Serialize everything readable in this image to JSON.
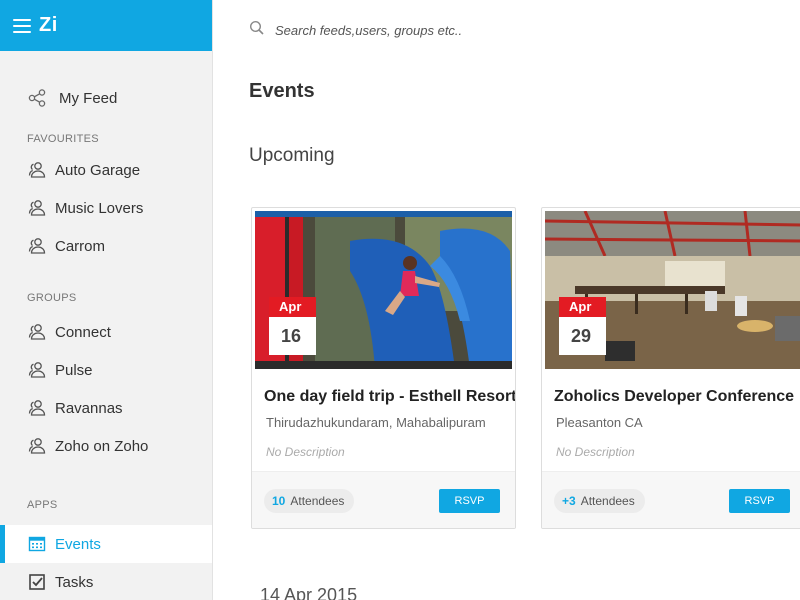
{
  "brand": {
    "logo_text": "Zi"
  },
  "search": {
    "placeholder": "Search feeds,users, groups etc.."
  },
  "sidebar": {
    "my_feed": "My Feed",
    "favourites_title": "FAVOURITES",
    "favourites": [
      "Auto Garage",
      "Music Lovers",
      "Carrom"
    ],
    "groups_title": "GROUPS",
    "groups": [
      "Connect",
      "Pulse",
      "Ravannas",
      "Zoho on Zoho"
    ],
    "apps_title": "APPS",
    "apps": [
      "Events",
      "Tasks"
    ]
  },
  "main": {
    "title": "Events",
    "section": "Upcoming",
    "date_heading": "14 Apr 2015"
  },
  "events": [
    {
      "month": "Apr",
      "day": "16",
      "title": "One day field trip - Esthell Resort",
      "location": "Thirudazhukundaram, Mahabalipuram",
      "description": "No Description",
      "attendees_count": "10",
      "attendees_label": "Attendees",
      "rsvp": "RSVP"
    },
    {
      "month": "Apr",
      "day": "29",
      "title": "Zoholics Developer Conference",
      "location": "Pleasanton CA",
      "description": "No Description",
      "attendees_count": "+3",
      "attendees_label": "Attendees",
      "rsvp": "RSVP"
    }
  ],
  "colors": {
    "accent": "#10a7e2",
    "date_red": "#e31b23",
    "sidebar_bg": "#f2f2f2"
  },
  "icons": {
    "menu": "hamburger-icon",
    "feed": "share-icon",
    "group": "group-icon",
    "search": "search-icon",
    "events": "calendar-icon",
    "tasks": "checkbox-icon"
  }
}
